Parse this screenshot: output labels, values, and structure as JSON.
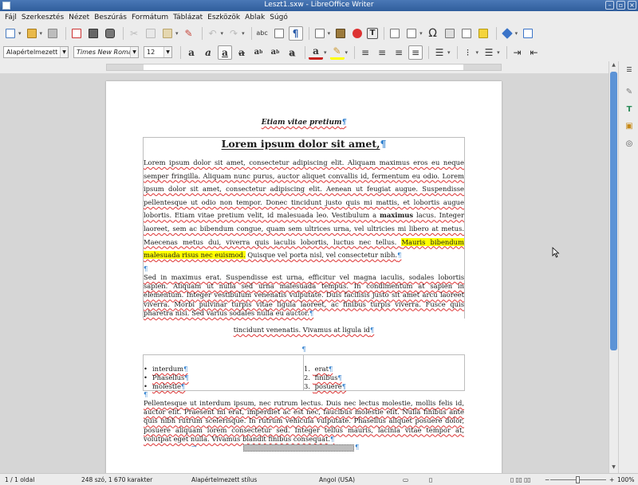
{
  "window": {
    "title": "Leszt1.sxw - LibreOffice Writer"
  },
  "menu": [
    "Fájl",
    "Szerkesztés",
    "Nézet",
    "Beszúrás",
    "Formátum",
    "Táblázat",
    "Eszközök",
    "Ablak",
    "Súgó"
  ],
  "format_bar": {
    "style": "Alapértelmezett st",
    "font": "Times New Roman",
    "size": "12"
  },
  "document": {
    "header": "Etiam vitae pretium",
    "heading": "Lorem ipsum dolor sit amet,",
    "p1": {
      "a": "Lorem ipsum dolor sit amet, consectetur adipiscing elit. Aliquam maximus eros eu neque semper fringilla. Aliquam nunc purus, auctor aliquet convallis id, fermentum eu odio. Lorem ipsum dolor sit amet, consectetur adipiscing elit. Aenean ut feugiat augue. Suspendisse pellentesque ut odio non tempor. Donec tincidunt justo quis mi mattis, et lobortis augue lobortis. Etiam vitae pretium velit, id malesuada leo. Vestibulum a ",
      "bold": "maximus",
      "b": " lacus. Integer laoreet, sem ac bibendum congue, quam sem ultrices urna, vel ultricies mi libero at metus. Maecenas metus dui, viverra quis iaculis lobortis, luctus nec tellus. ",
      "highlight": "Mauris bibendum malesuada risus nec euismod.",
      "c": " Quisque vel porta nisl, vel consectetur nibh."
    },
    "p2": "Sed in maximus erat. Suspendisse est urna, efficitur vel magna iaculis, sodales lobortis sapien. Aliquam ut nulla sed urna malesuada tempus. In condimentum at sapien in elementum. Integer vestibulum venenatis vulputate. Duis facilisis justo sit amet arcu laoreet viverra. Morbi pulvinar turpis vitae ligula laoreet, ac finibus turpis viverra. Fusce quis pharetra nisi. Sed varius sodales nulla eu auctor.",
    "p3": "tincidunt venenatis. Vivamus at ligula id",
    "bullets": [
      "interdum",
      "Phasellus",
      "molestie"
    ],
    "numbered": [
      "erat",
      "finibus",
      "posuere"
    ],
    "numbered_markers": [
      "1.",
      "2.",
      "3."
    ],
    "p4": "Pellentesque ut interdum ipsum, nec rutrum lectus. Duis nec lectus molestie, mollis felis id, auctor elit. Praesent mi erat, imperdiet ac est nec, faucibus molestie elit. Nulla finibus ante quis nibh rutrum scelerisque. In rutrum vehicula vulputate. Phasellus aliquet posuere dolor, posuere aliquam lorem consectetur sed. Integer tellus mauris, lacinia vitae tempor at, volutpat eget nulla. Vivamus blandit finibus consequat."
  },
  "status": {
    "page": "1 / 1 oldal",
    "words": "248 szó, 1 670 karakter",
    "style": "Alapértelmezett stílus",
    "language": "Angol (USA)",
    "zoom": "100%"
  },
  "colors": {
    "titlebar": "#2f5d9c",
    "highlight": "#ffff00",
    "scroll_thumb": "#5c93d6"
  }
}
